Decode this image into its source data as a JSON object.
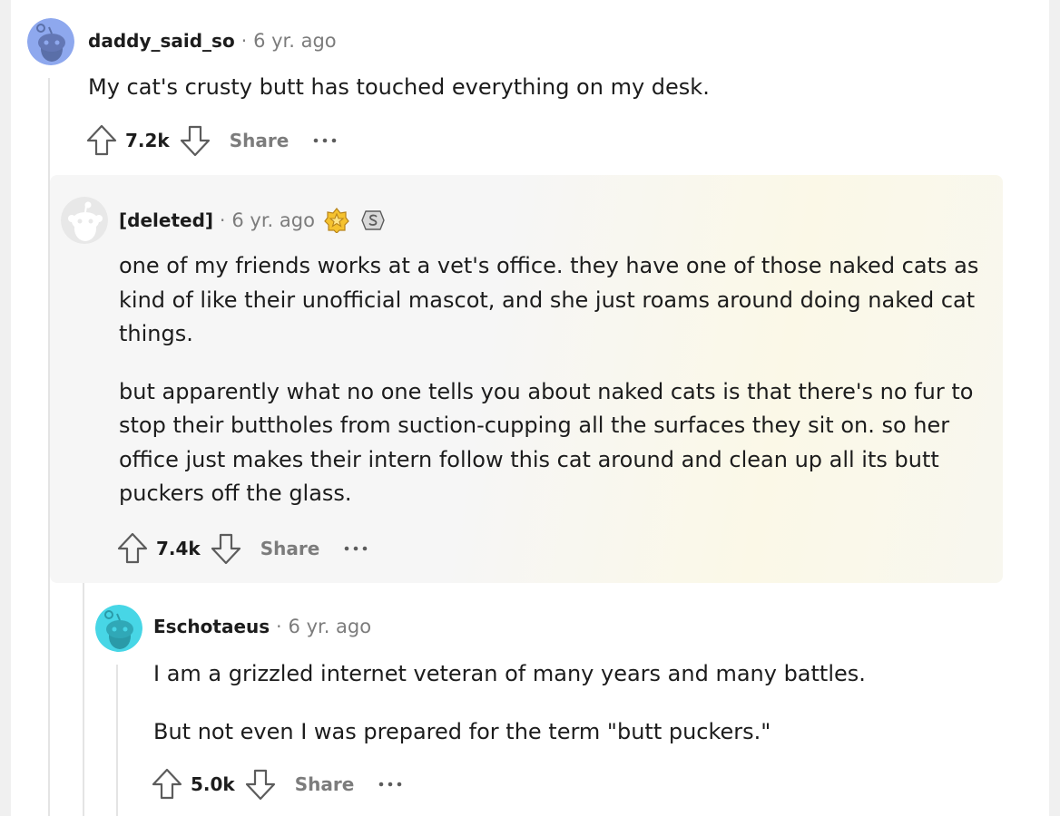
{
  "comments": [
    {
      "author": "daddy_said_so",
      "separator": "·",
      "time": "6 yr. ago",
      "paragraphs": [
        "My cat's crusty butt has touched everything on my desk."
      ],
      "score": "7.2k",
      "share_label": "Share",
      "avatar_color": "#8ea8ee"
    },
    {
      "author": "[deleted]",
      "separator": "·",
      "time": "6 yr. ago",
      "awards": [
        "star-award-icon",
        "silver-award-icon"
      ],
      "paragraphs": [
        "one of my friends works at a vet's office. they have one of those naked cats as kind of like their unofficial mascot, and she just roams around doing naked cat things.",
        "but apparently what no one tells you about naked cats is that there's no fur to stop their buttholes from suction-cupping all the surfaces they sit on. so her office just makes their intern follow this cat around and clean up all its butt puckers off the glass."
      ],
      "score": "7.4k",
      "share_label": "Share",
      "avatar_color": "#e8e8e8",
      "highlighted": true
    },
    {
      "author": "Eschotaeus",
      "separator": "·",
      "time": "6 yr. ago",
      "paragraphs": [
        "I am a grizzled internet veteran of many years and many battles.",
        "But not even I was prepared for the term \"butt puckers.\""
      ],
      "score": "5.0k",
      "share_label": "Share",
      "avatar_color": "#47d6e6"
    }
  ],
  "colors": {
    "meta_gray": "#7c7c7c",
    "thread_line": "#e4e4e4",
    "highlight_bg": "#f6f6f6"
  }
}
